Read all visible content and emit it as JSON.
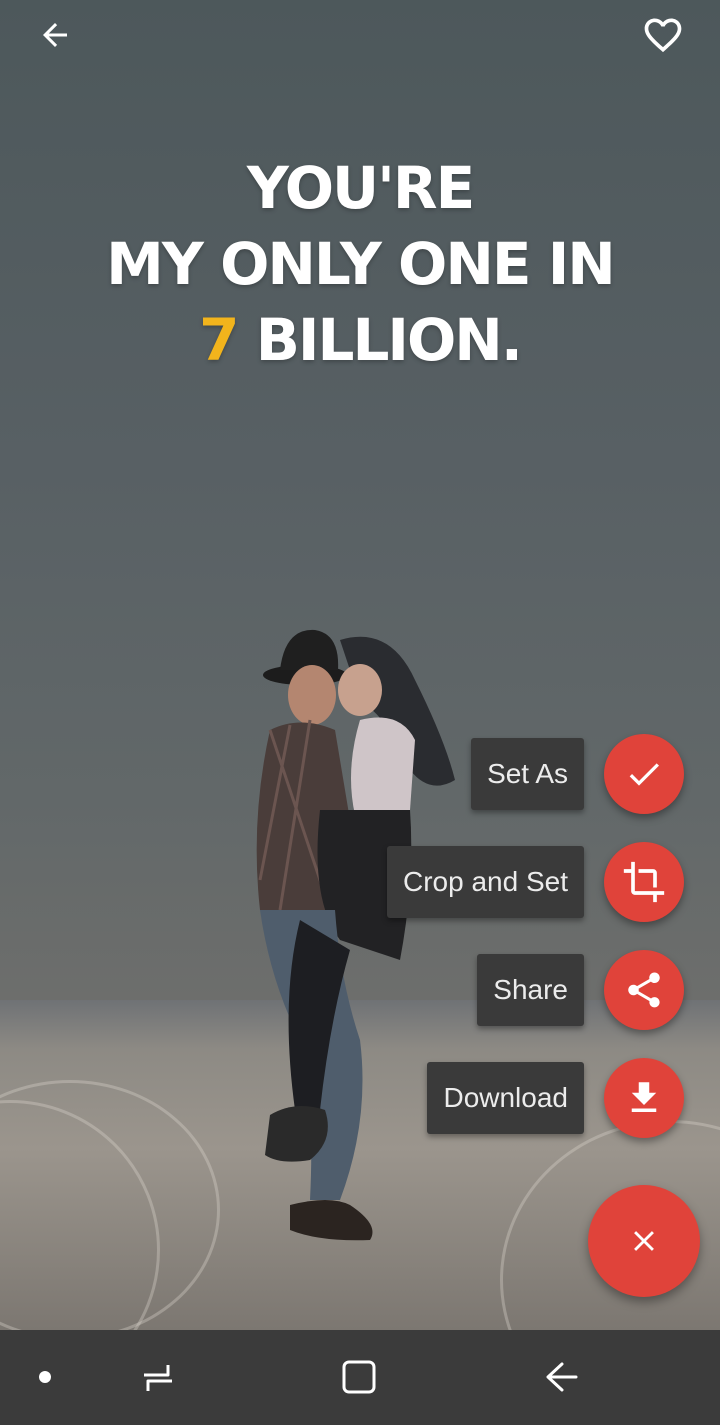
{
  "toolbar": {
    "back_icon": "arrow-left-icon",
    "favorite_icon": "heart-outline-icon"
  },
  "wallpaper": {
    "quote_line1": "YOU'RE",
    "quote_line2": "MY ONLY ONE IN",
    "quote_line3_accent": "7",
    "quote_line3_rest": " BILLION.",
    "accent_color": "#f2b41c"
  },
  "fab_menu": {
    "items": [
      {
        "label": "Set As",
        "icon": "check-icon"
      },
      {
        "label": "Crop and Set",
        "icon": "crop-icon"
      },
      {
        "label": "Share",
        "icon": "share-icon"
      },
      {
        "label": "Download",
        "icon": "download-icon"
      }
    ],
    "close_icon": "close-icon",
    "fab_color": "#e0433a"
  },
  "navbar": {
    "icons": [
      "dot-icon",
      "recents-icon",
      "home-icon",
      "back-icon"
    ]
  }
}
